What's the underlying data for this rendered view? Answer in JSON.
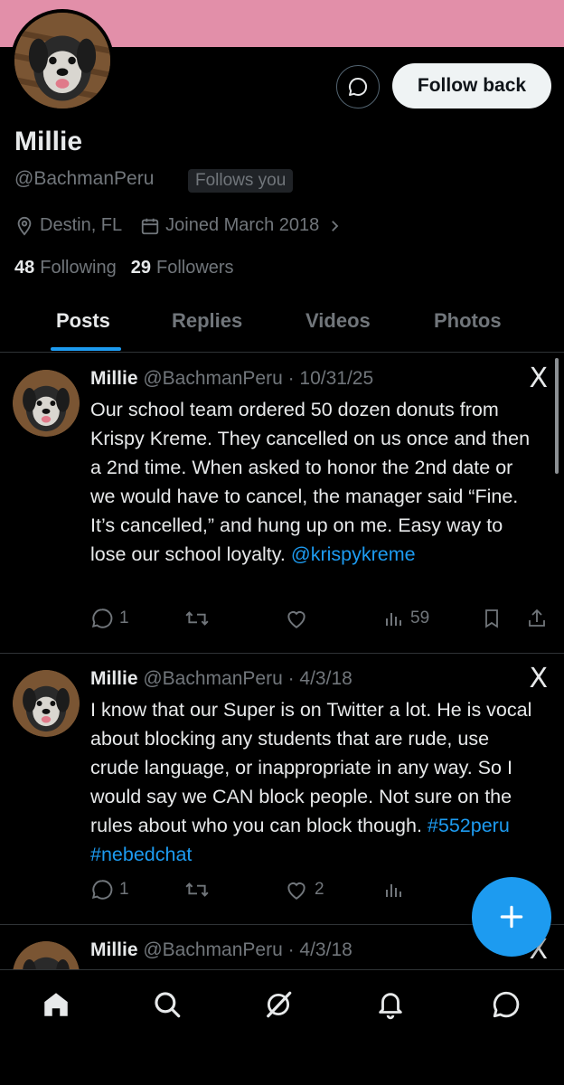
{
  "profile": {
    "name": "Millie",
    "handle": "@BachmanPeru",
    "follows_you": "Follows you",
    "location": "Destin, FL",
    "joined": "Joined March 2018",
    "following_count": "48",
    "following_label": "Following",
    "followers_count": "29",
    "followers_label": "Followers",
    "follow_back_label": "Follow back",
    "banner_color": "#e28fa9"
  },
  "tabs": [
    {
      "label": "Posts",
      "active": true
    },
    {
      "label": "Replies",
      "active": false
    },
    {
      "label": "Videos",
      "active": false
    },
    {
      "label": "Photos",
      "active": false
    }
  ],
  "posts": [
    {
      "name": "Millie",
      "handle_date": "@BachmanPeru · 10/31/25",
      "text": "Our school team ordered 50 dozen donuts from Krispy Kreme. They cancelled on us once and then a 2nd time. When asked to honor the 2nd date or we would have to cancel, the manager said “Fine. It’s cancelled,” and hung up on me. Easy way to lose our school loyalty. ",
      "link": "@krispykreme",
      "replies": "1",
      "reposts": "",
      "likes": "",
      "views": "59",
      "source_icon": "X"
    },
    {
      "name": "Millie",
      "handle_date": "@BachmanPeru · 4/3/18",
      "text": "I know that our Super is on Twitter a lot.  He is vocal about blocking any students that are rude, use crude language, or inappropriate in any way. So I would say we CAN block people.  Not sure on the rules about who you can block though. ",
      "link": "#552peru #nebedchat",
      "replies": "1",
      "reposts": "",
      "likes": "2",
      "views": "",
      "source_icon": "X"
    },
    {
      "name": "Millie",
      "handle_date": "@BachmanPeru · 4/3/18",
      "source_icon": "X"
    }
  ],
  "nav": [
    "home-icon",
    "search-icon",
    "grok-icon",
    "notifications-icon",
    "messages-icon"
  ],
  "colors": {
    "accent": "#1d9bf0",
    "muted": "#71767b",
    "divider": "#2f3336"
  }
}
